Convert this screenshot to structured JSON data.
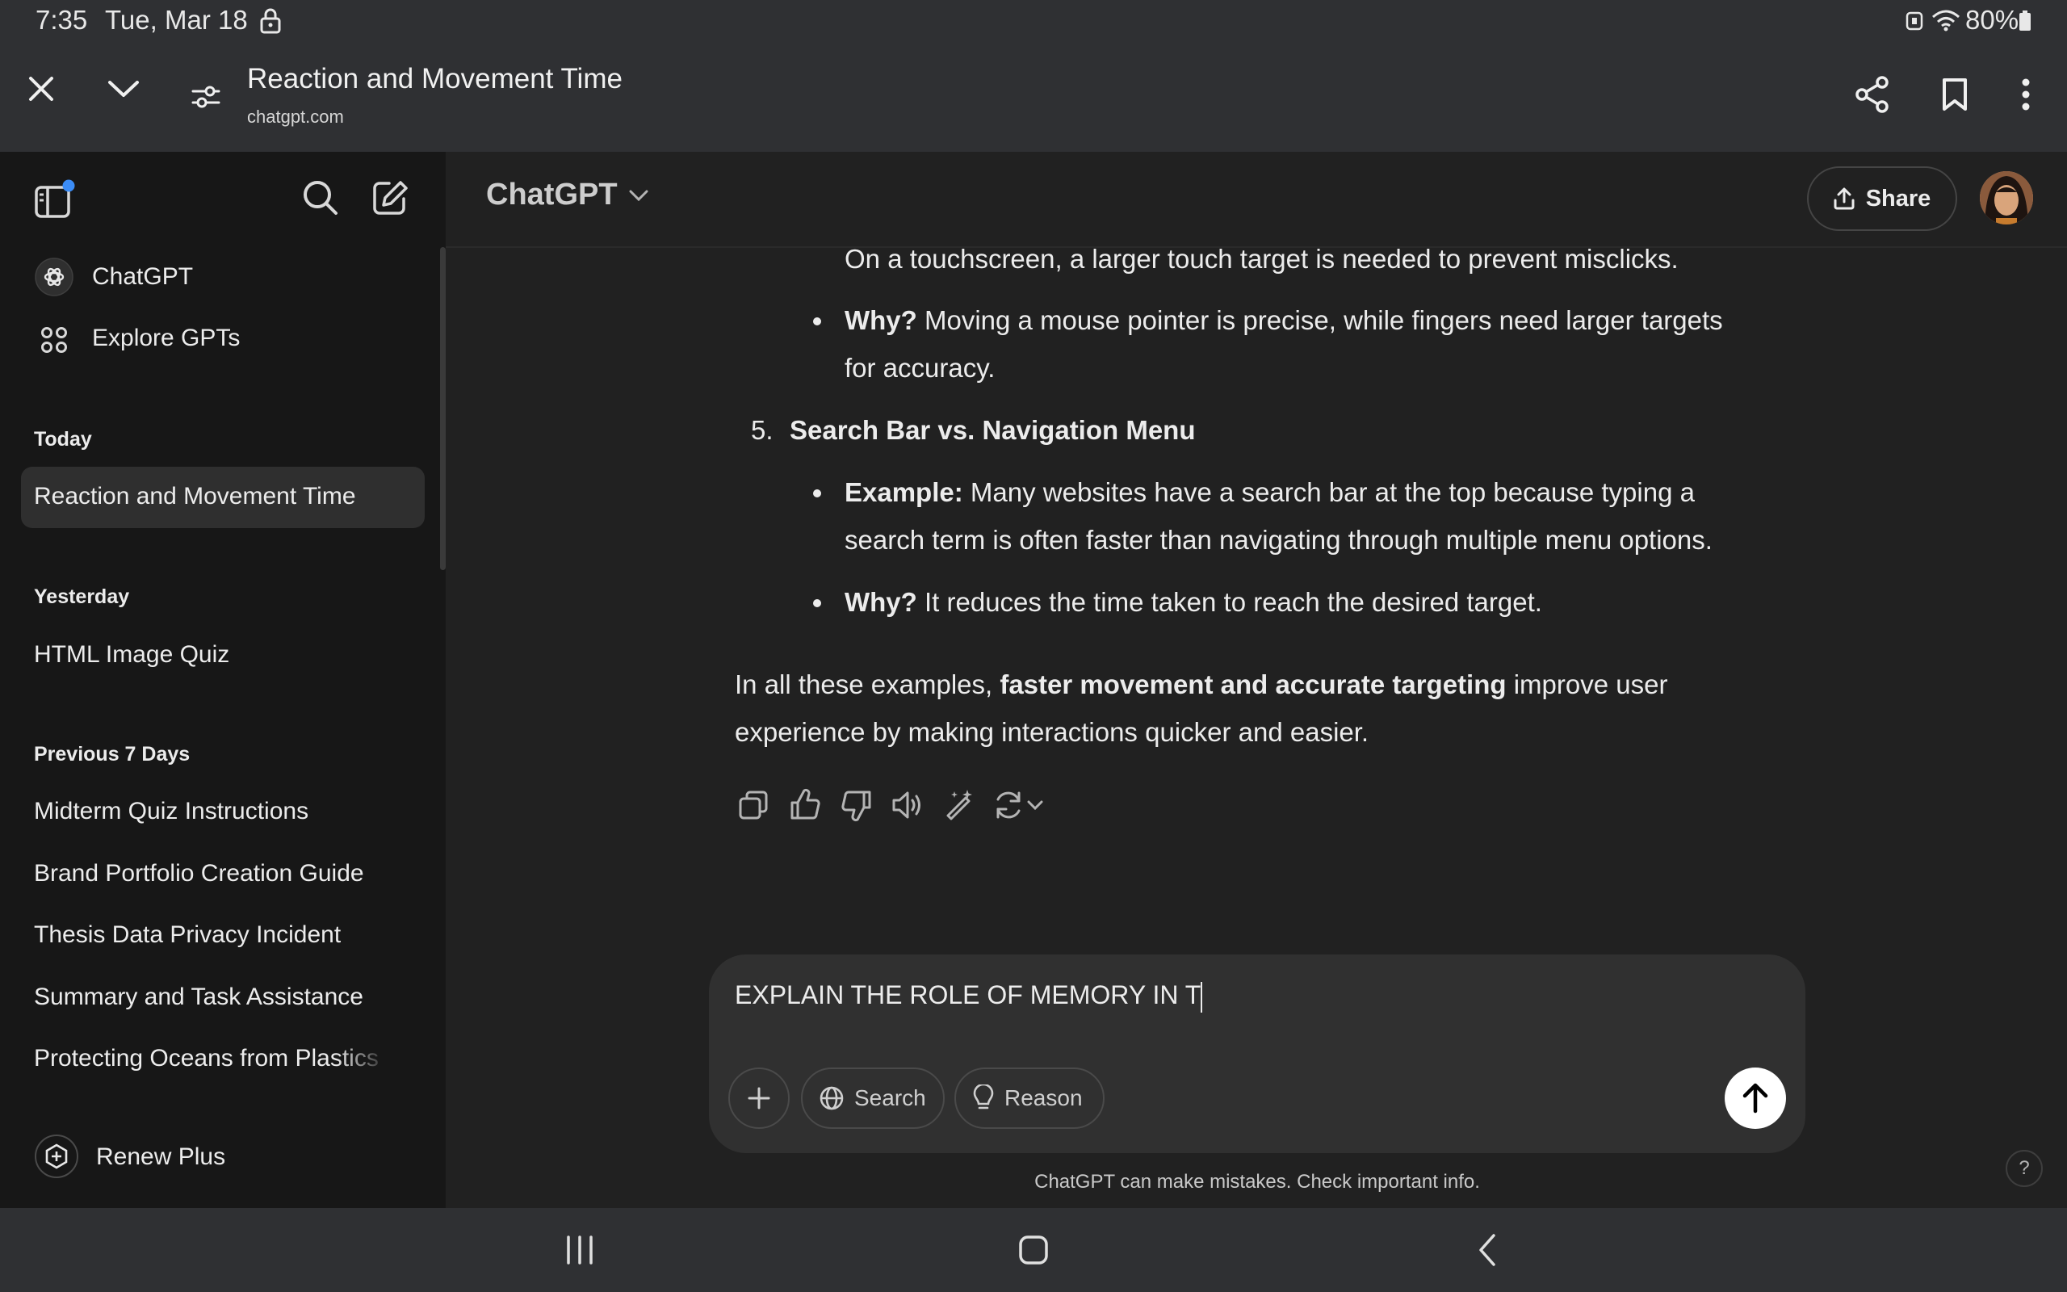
{
  "status": {
    "time": "7:35",
    "date": "Tue, Mar 18",
    "battery": "80%"
  },
  "browser": {
    "title": "Reaction and Movement Time",
    "url": "chatgpt.com"
  },
  "sidebar": {
    "primary": [
      {
        "label": "ChatGPT",
        "icon": "openai-logo-icon"
      },
      {
        "label": "Explore GPTs",
        "icon": "grid-icon"
      }
    ],
    "sections": [
      {
        "label": "Today",
        "items": [
          "Reaction and Movement Time"
        ]
      },
      {
        "label": "Yesterday",
        "items": [
          "HTML Image Quiz"
        ]
      },
      {
        "label": "Previous 7 Days",
        "items": [
          "Midterm Quiz Instructions",
          "Brand Portfolio Creation Guide",
          "Thesis Data Privacy Incident",
          "Summary and Task Assistance",
          "Protecting Oceans from Plastics"
        ]
      }
    ],
    "renew": "Renew Plus"
  },
  "header": {
    "model": "ChatGPT",
    "share": "Share"
  },
  "message": {
    "line1": "On a touchscreen, a larger touch target is needed to prevent misclicks.",
    "why1_label": "Why?",
    "why1_a": " Moving a mouse pointer is precise, while fingers need larger targets",
    "why1_b": "for accuracy.",
    "item5_num": "5.",
    "item5_title": "Search Bar vs. Navigation Menu",
    "example_label": "Example:",
    "example_a": " Many websites have a search bar at the top because typing a",
    "example_b": "search term is often faster than navigating through multiple menu options.",
    "why2_label": "Why?",
    "why2_a": " It reduces the time taken to reach the desired target.",
    "summary_pre": "In all these examples, ",
    "summary_bold": "faster movement and accurate targeting",
    "summary_post": " improve user",
    "summary_b": "experience by making interactions quicker and easier."
  },
  "composer": {
    "value": "EXPLAIN THE ROLE OF MEMORY IN T",
    "search": "Search",
    "reason": "Reason"
  },
  "disclaimer": "ChatGPT can make mistakes. Check important info.",
  "help": "?"
}
